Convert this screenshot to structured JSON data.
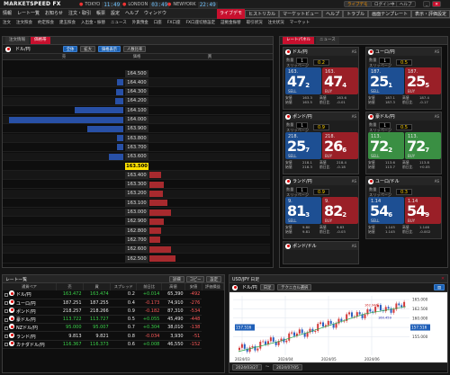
{
  "app": {
    "logo_a": "MARKET",
    "logo_b": "SPEED FX",
    "clocks": [
      {
        "city": "TOKYO",
        "time": "11:49"
      },
      {
        "city": "LONDON",
        "time": "03:49"
      },
      {
        "city": "NEWYORK",
        "time": "22:49"
      }
    ],
    "buttons": [
      "ライブデモ",
      "ログイン中",
      "ヘルプ",
      "最小化",
      "閉じる"
    ]
  },
  "menu": {
    "items": [
      "情報",
      "レート一覧",
      "お知らせ",
      "注文・取引",
      "帳票",
      "設定",
      "ヘルプ",
      "ウィンドウ"
    ],
    "right": [
      "ライブデモ",
      "ヒストリカル",
      "マーケットビュー",
      "ヘルプ",
      "トラブル",
      "画面テンプレート",
      "表示・評価設定"
    ]
  },
  "toolbar": {
    "items": [
      "注文",
      "注文照会",
      "約定照会",
      "建玉照会",
      "入出金・振替",
      "ニュース",
      "外貨預金",
      "口座",
      "FX口座",
      "FX口座切替設定",
      "証拠金振替",
      "取引状況",
      "注文状況",
      "マーケット",
      "プレミアム",
      "ツール",
      "設定"
    ]
  },
  "book": {
    "title": "注文一覧 / 板情報",
    "tabs": [
      "注文情報",
      "価格帯"
    ],
    "pair": "ドル/円",
    "buttons": [
      "全体",
      "拡大",
      "価格表示",
      "人数比率"
    ],
    "cols": [
      "売",
      "価格",
      "買"
    ],
    "rows": [
      {
        "price": "164.500",
        "bid": 0,
        "ask": 0
      },
      {
        "price": "164.400",
        "bid": 0.05,
        "ask": 0
      },
      {
        "price": "164.300",
        "bid": 0.06,
        "ask": 0
      },
      {
        "price": "164.200",
        "bid": 0.07,
        "ask": 0
      },
      {
        "price": "164.100",
        "bid": 0.4,
        "ask": 0
      },
      {
        "price": "164.000",
        "bid": 0.95,
        "ask": 0
      },
      {
        "price": "163.900",
        "bid": 0.3,
        "ask": 0
      },
      {
        "price": "163.800",
        "bid": 0.05,
        "ask": 0
      },
      {
        "price": "163.700",
        "bid": 0.05,
        "ask": 0
      },
      {
        "price": "163.600",
        "bid": 0.12,
        "ask": 0
      },
      {
        "price": "163.500",
        "bid": 0,
        "ask": 0,
        "cur": true
      },
      {
        "price": "163.400",
        "bid": 0,
        "ask": 0.1
      },
      {
        "price": "163.300",
        "bid": 0,
        "ask": 0.12
      },
      {
        "price": "163.200",
        "bid": 0,
        "ask": 0.11
      },
      {
        "price": "163.100",
        "bid": 0,
        "ask": 0.15
      },
      {
        "price": "163.000",
        "bid": 0,
        "ask": 0.18
      },
      {
        "price": "162.900",
        "bid": 0,
        "ask": 0.12
      },
      {
        "price": "162.800",
        "bid": 0,
        "ask": 0.1
      },
      {
        "price": "162.700",
        "bid": 0,
        "ask": 0.09
      },
      {
        "price": "162.600",
        "bid": 0,
        "ask": 0.18
      },
      {
        "price": "162.500",
        "bid": 0,
        "ask": 0.22
      }
    ]
  },
  "tiles_panel": {
    "title": "レートパネル",
    "tab2": "ニュース"
  },
  "tiles": [
    {
      "pair": "ドル/円",
      "code": "AS",
      "qty_label": "数量",
      "qty": "1",
      "spread_label": "スリッページ",
      "spread": "0.2",
      "sell_small": "163.",
      "sell_big": "47",
      "sell_sub": "2",
      "buy_small": "163.",
      "buy_big": "47",
      "buy_sub": "4",
      "sell_lbl": "SELL",
      "buy_lbl": "BUY",
      "stats": [
        "安値",
        "163.3",
        "高値",
        "163.6",
        "始値",
        "163.5",
        "前日比",
        "-0.01"
      ],
      "up": false
    },
    {
      "pair": "ユーロ/円",
      "code": "AS",
      "qty_label": "数量",
      "qty": "1",
      "spread_label": "スリッページ",
      "spread": "0.5",
      "sell_small": "187.",
      "sell_big": "25",
      "sell_sub": "1",
      "buy_small": "187.",
      "buy_big": "25",
      "buy_sub": "5",
      "sell_lbl": "SELL",
      "buy_lbl": "BUY",
      "stats": [
        "安値",
        "187.1",
        "高値",
        "187.4",
        "始値",
        "187.3",
        "前日比",
        "-0.17"
      ],
      "up": false
    },
    {
      "pair": "ポンド/円",
      "code": "AS",
      "qty_label": "数量",
      "qty": "1",
      "spread_label": "スリッページ",
      "spread": "0.9",
      "sell_small": "218.",
      "sell_big": "25",
      "sell_sub": "7",
      "buy_small": "218.",
      "buy_big": "26",
      "buy_sub": "6",
      "sell_lbl": "SELL",
      "buy_lbl": "BUY",
      "stats": [
        "安値",
        "218.1",
        "高値",
        "218.4",
        "始値",
        "218.3",
        "前日比",
        "-0.18"
      ],
      "up": false
    },
    {
      "pair": "豪ドル/円",
      "code": "AS",
      "qty_label": "数量",
      "qty": "1",
      "spread_label": "スリッページ",
      "spread": "0.5",
      "sell_small": "113.",
      "sell_big": "72",
      "sell_sub": "2",
      "buy_small": "113.",
      "buy_big": "72",
      "buy_sub": "7",
      "sell_lbl": "SELL",
      "buy_lbl": "BUY",
      "stats": [
        "安値",
        "113.6",
        "高値",
        "113.8",
        "始値",
        "113.7",
        "前日比",
        "+0.05"
      ],
      "up": true
    },
    {
      "pair": "ランド/円",
      "code": "AS",
      "qty_label": "数量",
      "qty": "1",
      "spread_label": "スリッページ",
      "spread": "0.9",
      "sell_small": "9.",
      "sell_big": "81",
      "sell_sub": "3",
      "buy_small": "9.",
      "buy_big": "82",
      "buy_sub": "2",
      "sell_lbl": "SELL",
      "buy_lbl": "BUY",
      "stats": [
        "安値",
        "9.80",
        "高値",
        "9.83",
        "始値",
        "9.81",
        "前日比",
        "-0.03"
      ],
      "up": false
    },
    {
      "pair": "ユーロ/ドル",
      "code": "AS",
      "qty_label": "数量",
      "qty": "1",
      "spread_label": "スリッページ",
      "spread": "0.3",
      "sell_small": "1.14",
      "sell_big": "54",
      "sell_sub": "6",
      "buy_small": "1.14",
      "buy_big": "54",
      "buy_sub": "9",
      "sell_lbl": "SELL",
      "buy_lbl": "BUY",
      "stats": [
        "安値",
        "1.145",
        "高値",
        "1.146",
        "始値",
        "1.145",
        "前日比",
        "-0.002"
      ],
      "up": false
    }
  ],
  "tile7": {
    "pair": "ポンド/ドル",
    "code": "AS"
  },
  "rates": {
    "title": "レート一覧",
    "buttons": [
      "詳細",
      "コピー",
      "設定"
    ],
    "cols": [
      "通貨ペア",
      "売",
      "買",
      "スプレッド",
      "前日比",
      "高値",
      "安値",
      "評価損益"
    ],
    "rows": [
      [
        "ドル/円",
        "163.472",
        "163.474",
        "0.2",
        "+0.014",
        "65,390",
        "-492"
      ],
      [
        "ユーロ/円",
        "187.251",
        "187.255",
        "0.4",
        "-0.173",
        "74,910",
        "-276"
      ],
      [
        "ポンド/円",
        "218.257",
        "218.266",
        "0.9",
        "-0.182",
        "87,310",
        "-534"
      ],
      [
        "豪ドル/円",
        "113.722",
        "113.727",
        "0.5",
        "+0.055",
        "45,490",
        "-448"
      ],
      [
        "NZドル/円",
        "95.000",
        "95.007",
        "0.7",
        "+0.304",
        "38,010",
        "-138"
      ],
      [
        "ランド/円",
        "9.813",
        "9.821",
        "0.8",
        "-0.034",
        "3,930",
        "-51"
      ],
      [
        "カナダドル/円",
        "116.367",
        "116.373",
        "0.6",
        "+0.008",
        "46,550",
        "-152"
      ]
    ]
  },
  "chart": {
    "title": "USD/JPY 日足",
    "pair": "ドル/円",
    "tabs": [
      "日足",
      "テクニカル選択"
    ],
    "ylabels": [
      "165.000",
      "162.500",
      "160.000",
      "157.500",
      "155.000"
    ],
    "xlabels": [
      "2024/03",
      "2024/04",
      "2024/05",
      "2024/06"
    ],
    "last": "157.516",
    "marker_hi": "162.946",
    "marker_lo": "160.459",
    "from": "2024/03/27",
    "to": "2024/07/05",
    "chart_data": {
      "type": "line",
      "x": [
        "2024/03",
        "2024/04",
        "2024/05",
        "2024/06",
        "2024/07"
      ],
      "y": [
        151.4,
        154.2,
        157.8,
        161.5,
        163.5
      ],
      "ylim": [
        150,
        166
      ]
    }
  }
}
